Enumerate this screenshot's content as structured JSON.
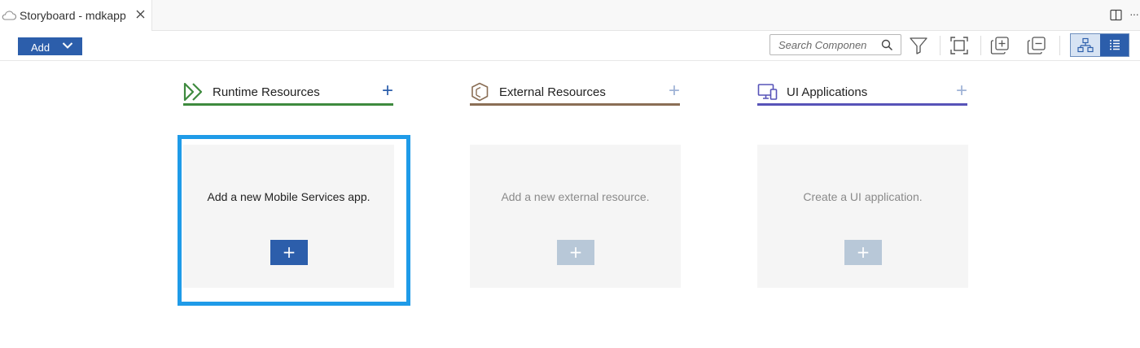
{
  "tab": {
    "title": "Storyboard - mdkapp",
    "icon": "cloud-icon"
  },
  "toolbar": {
    "add_label": "Add",
    "search_placeholder": "Search Componen",
    "icons": [
      "filter-icon",
      "fit-to-screen-icon",
      "expand-all-icon",
      "collapse-all-icon",
      "hierarchy-view-icon",
      "list-view-icon"
    ]
  },
  "columns": [
    {
      "title": "Runtime Resources",
      "accent": "#3e8a3e",
      "icon": "runtime-resources-icon",
      "card_text": "Add a new Mobile Services app.",
      "card_button": "+",
      "enabled": true
    },
    {
      "title": "External Resources",
      "accent": "#8a6e55",
      "icon": "external-resources-icon",
      "card_text": "Add a new external resource.",
      "card_button": "+",
      "enabled": false
    },
    {
      "title": "UI Applications",
      "accent": "#5753b8",
      "icon": "ui-applications-icon",
      "card_text": "Create a UI application.",
      "card_button": "+",
      "enabled": false
    }
  ],
  "colors": {
    "primary": "#2c5eab",
    "disabled_button": "#b8c8d8",
    "highlight": "#1f9be8"
  }
}
